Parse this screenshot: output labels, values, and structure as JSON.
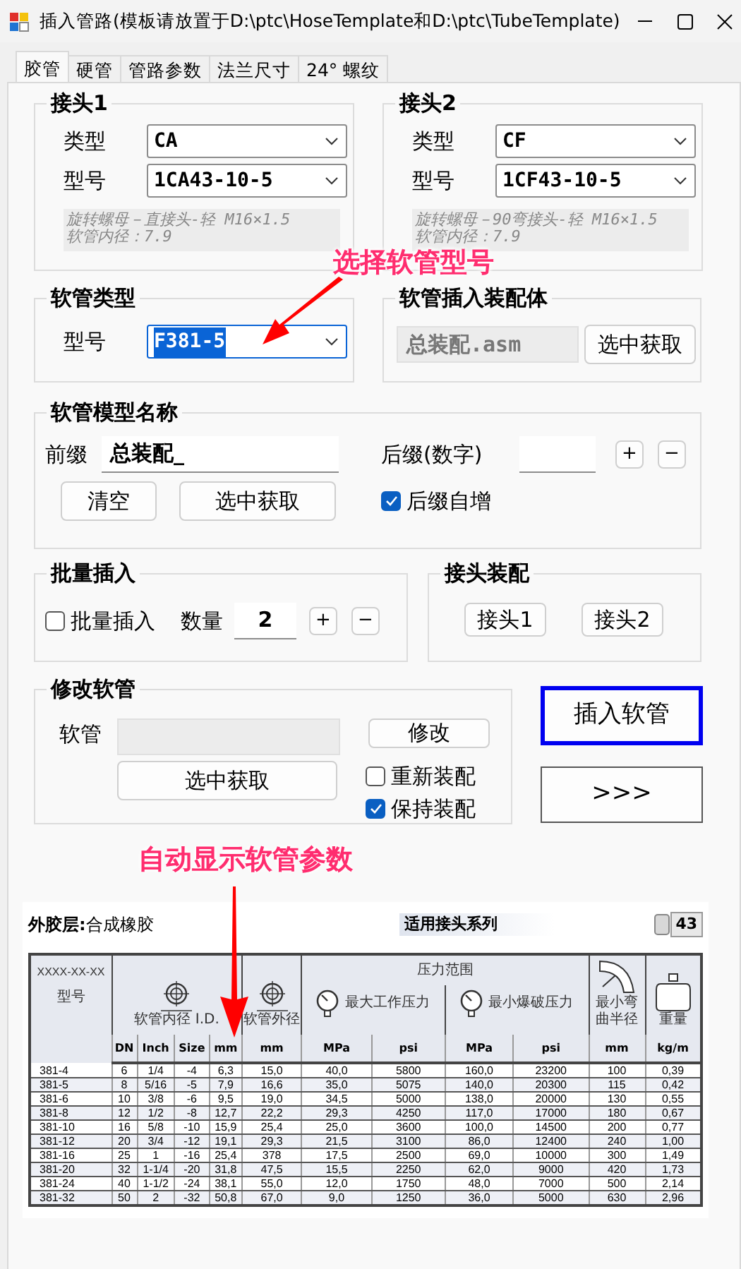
{
  "window": {
    "title": "插入管路(模板请放置于D:\\ptc\\HoseTemplate和D:\\ptc\\TubeTemplate)"
  },
  "tabs": [
    {
      "label": "胶管",
      "selected": true
    },
    {
      "label": "硬管",
      "selected": false
    },
    {
      "label": "管路参数",
      "selected": false
    },
    {
      "label": "法兰尺寸",
      "selected": false
    },
    {
      "label": "24° 螺纹",
      "selected": false
    }
  ],
  "joints": [
    {
      "title": "接头1",
      "type_label": "类型",
      "type": "CA",
      "model_label": "型号",
      "model": "1CA43-10-5",
      "description": [
        "旋转螺母－直接头-轻 M16×1.5",
        "软管内径：7.9"
      ]
    },
    {
      "title": "接头2",
      "type_label": "类型",
      "type": "CF",
      "model_label": "型号",
      "model": "1CF43-10-5",
      "description": [
        "旋转螺母－90弯接头-轻 M16×1.5",
        "软管内径：7.9"
      ]
    }
  ],
  "hose_type": {
    "title": "软管类型",
    "model_label": "型号",
    "model": "F381-5",
    "text_selected": true
  },
  "hose_assembly": {
    "title": "软管插入装配体",
    "value": "总装配.asm",
    "button": "选中获取"
  },
  "hose_name": {
    "title": "软管模型名称",
    "prefix_label": "前缀",
    "prefix": "总装配_",
    "suffix_label": "后缀(数字)",
    "plus": "+",
    "minus": "−",
    "clear_button": "清空",
    "pick_button": "选中获取",
    "auto_increment": {
      "label": "后缀自增",
      "checked": true
    }
  },
  "batch": {
    "title": "批量插入",
    "checkbox": {
      "label": "批量插入",
      "checked": false
    },
    "quantity_label": "数量",
    "quantity": "2",
    "plus": "+",
    "minus": "−"
  },
  "joint_assembly": {
    "title": "接头装配",
    "buttons": [
      "接头1",
      "接头2"
    ]
  },
  "modify": {
    "title": "修改软管",
    "hose_label": "软管",
    "modify_button": "修改",
    "pick_button": "选中获取",
    "options": [
      {
        "label": "重新装配",
        "checked": false
      },
      {
        "label": "保持装配",
        "checked": true
      }
    ]
  },
  "insert_button": "插入软管",
  "more_button": ">>>",
  "annotations": [
    "选择软管型号",
    "自动显示软管参数"
  ],
  "catalog": {
    "outer_layer": "**外胶层:**合成橡胶",
    "series_title": "适用接头系列",
    "series_number": "43",
    "model_pattern": "XXXX-XX-XX",
    "model_header": "型号",
    "id_header": "软管内径 I.D.",
    "od_header": "软管外径",
    "pressure_header": "压力范围",
    "working_header": "最大工作压力",
    "burst_header": "最小爆破压力",
    "bend_header": "最小弯曲半径",
    "weight_header": "重量",
    "units": [
      "DN",
      "Inch",
      "Size",
      "mm",
      "mm",
      "MPa",
      "psi",
      "MPa",
      "psi",
      "mm",
      "kg/m"
    ],
    "rows": [
      [
        "381-4",
        "6",
        "1/4",
        "-4",
        "6,3",
        "15,0",
        "40,0",
        "5800",
        "160,0",
        "23200",
        "100",
        "0,39"
      ],
      [
        "381-5",
        "8",
        "5/16",
        "-5",
        "7,9",
        "16,6",
        "35,0",
        "5075",
        "140,0",
        "20300",
        "115",
        "0,42"
      ],
      [
        "381-6",
        "10",
        "3/8",
        "-6",
        "9,5",
        "19,0",
        "34,5",
        "5000",
        "138,0",
        "20000",
        "130",
        "0,55"
      ],
      [
        "381-8",
        "12",
        "1/2",
        "-8",
        "12,7",
        "22,2",
        "29,3",
        "4250",
        "117,0",
        "17000",
        "180",
        "0,67"
      ],
      [
        "381-10",
        "16",
        "5/8",
        "-10",
        "15,9",
        "25,4",
        "25,0",
        "3600",
        "100,0",
        "14500",
        "200",
        "0,77"
      ],
      [
        "381-12",
        "20",
        "3/4",
        "-12",
        "19,1",
        "29,3",
        "21,5",
        "3100",
        "86,0",
        "12400",
        "240",
        "1,00"
      ],
      [
        "381-16",
        "25",
        "1",
        "-16",
        "25,4",
        "378",
        "17,5",
        "2500",
        "69,0",
        "10000",
        "300",
        "1,49"
      ],
      [
        "381-20",
        "32",
        "1-1/4",
        "-20",
        "31,8",
        "47,5",
        "15,5",
        "2250",
        "62,0",
        "9000",
        "420",
        "1,73"
      ],
      [
        "381-24",
        "40",
        "1-1/2",
        "-24",
        "38,1",
        "55,0",
        "12,0",
        "1750",
        "48,0",
        "7000",
        "500",
        "2,14"
      ],
      [
        "381-32",
        "50",
        "2",
        "-32",
        "50,8",
        "67,0",
        "9,0",
        "1250",
        "36,0",
        "5000",
        "630",
        "2,96"
      ]
    ]
  }
}
